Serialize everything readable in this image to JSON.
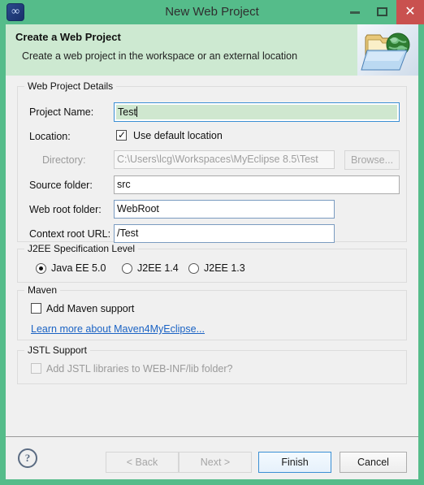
{
  "window": {
    "title": "New Web Project",
    "app_icon": "myeclipse-icon",
    "controls": {
      "minimize": "minimize-icon",
      "maximize": "maximize-icon",
      "close": "✕"
    },
    "colors": {
      "titlebar_green": "#55BC8A",
      "banner_green": "#CDE9D1",
      "body_grey": "#F0F0F0",
      "close_red": "#C9514F",
      "accent_blue": "#3A8FD4",
      "link_blue": "#1B63C4",
      "valid_field_green": "#CFE7CF"
    }
  },
  "header": {
    "title": "Create a Web Project",
    "subtitle": "Create a web project in the workspace or an external location",
    "icon": "web-project-folder-globe-icon"
  },
  "groups": {
    "web_project_details": {
      "legend": "Web Project Details",
      "fields": {
        "project_name": {
          "label": "Project Name:",
          "value": "Test",
          "placeholder": ""
        },
        "location": {
          "label": "Location:",
          "checkbox_label": "Use default location",
          "checked": true
        },
        "directory": {
          "label": "Directory:",
          "value": "C:\\Users\\lcg\\Workspaces\\MyEclipse 8.5\\Test",
          "disabled": true,
          "browse_label": "Browse..."
        },
        "source_folder": {
          "label": "Source folder:",
          "value": "src"
        },
        "web_root_folder": {
          "label": "Web root folder:",
          "value": "WebRoot"
        },
        "context_root_url": {
          "label": "Context root URL:",
          "value": "/Test"
        }
      }
    },
    "j2ee_specification_level": {
      "legend": "J2EE Specification Level",
      "options": [
        {
          "label": "Java EE 5.0",
          "selected": true
        },
        {
          "label": "J2EE 1.4",
          "selected": false
        },
        {
          "label": "J2EE 1.3",
          "selected": false
        }
      ]
    },
    "maven": {
      "legend": "Maven",
      "checkbox_label": "Add Maven support",
      "checked": false,
      "link_label": "Learn more about Maven4MyEclipse..."
    },
    "jstl_support": {
      "legend": "JSTL Support",
      "checkbox_label": "Add JSTL libraries to WEB-INF/lib folder?",
      "checked": false,
      "disabled": true
    }
  },
  "footer": {
    "help_icon": "?",
    "buttons": {
      "back": {
        "label": "< Back",
        "disabled": true
      },
      "next": {
        "label": "Next >",
        "disabled": true
      },
      "finish": {
        "label": "Finish",
        "default": true
      },
      "cancel": {
        "label": "Cancel",
        "disabled": false
      }
    }
  }
}
